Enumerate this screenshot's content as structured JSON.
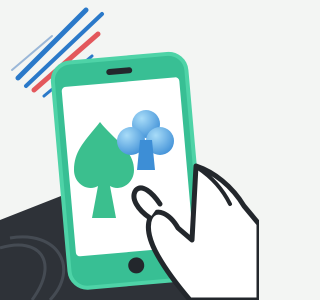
{
  "illustration": {
    "subject": "smartphone-with-card-suits-held-in-hand",
    "icons": [
      "spade-icon",
      "club-icon"
    ],
    "colors": {
      "background": "#f3f5f3",
      "dark_base": "#2e3238",
      "phone_outline": "#4ed3a7",
      "phone_body": "#38bf94",
      "screen": "#ffffff",
      "spade": "#3bbf8e",
      "club_light": "#8cd0f5",
      "club_dark": "#3d8ed6",
      "stripe_blue": "#2a79c9",
      "stripe_red": "#e3585c",
      "hand_outline": "#23272c",
      "hand_skin": "#ffffff"
    }
  }
}
